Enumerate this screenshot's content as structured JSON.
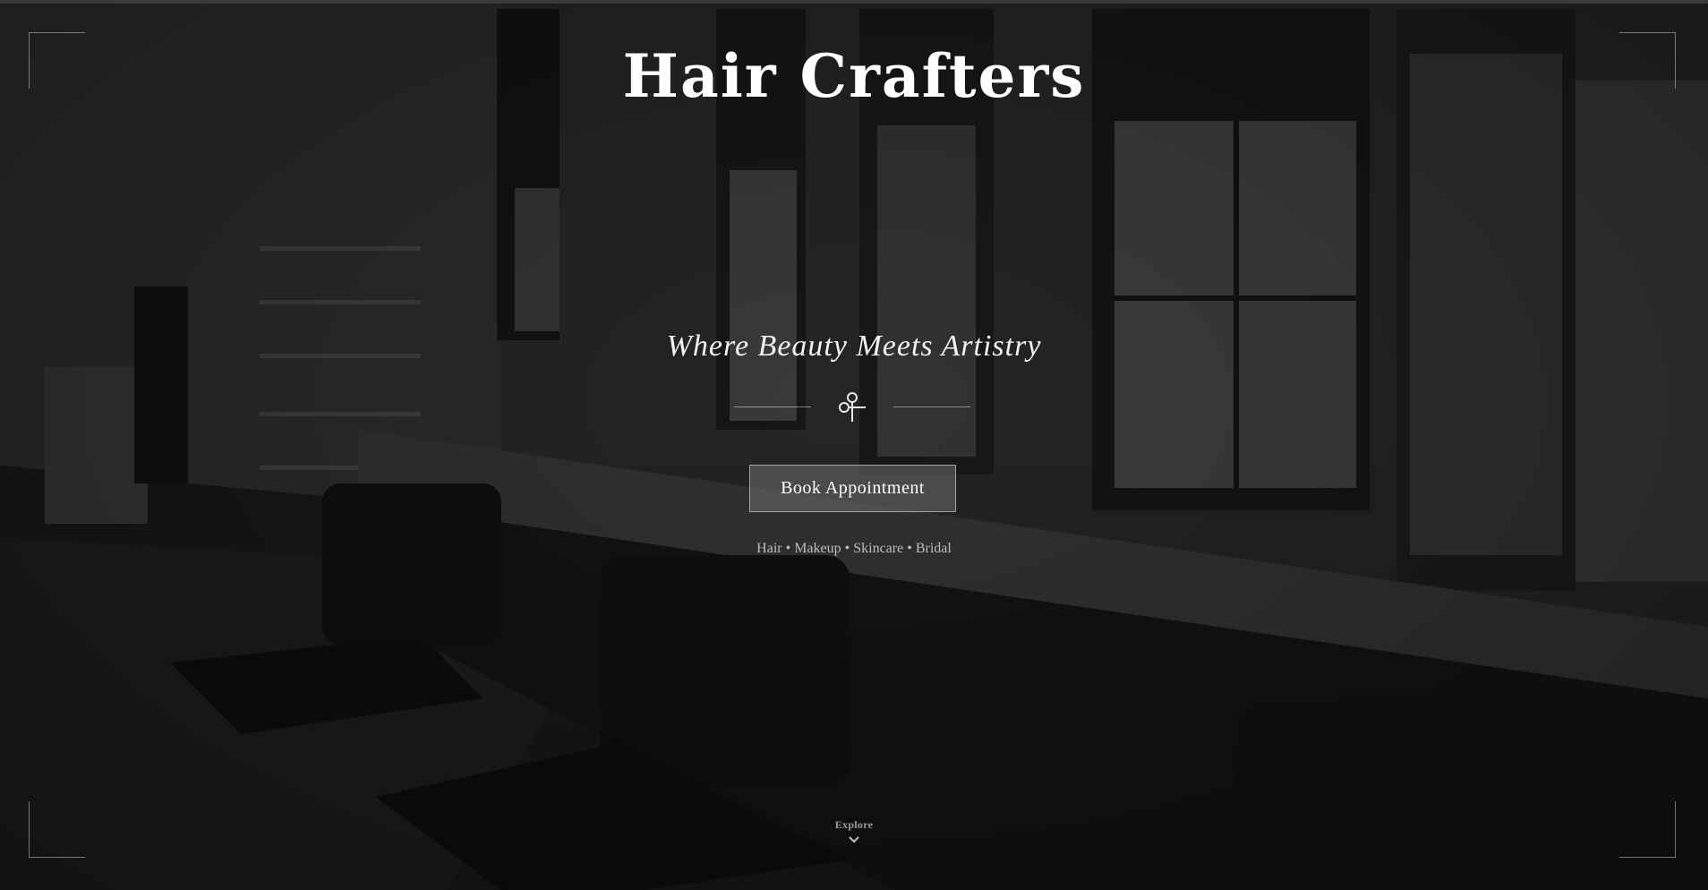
{
  "brand": {
    "title": "Hair Crafters",
    "tagline": "Where Beauty Meets Artistry"
  },
  "divider": {
    "icon": "scissors-icon"
  },
  "cta": {
    "book_label": "Book Appointment"
  },
  "services": {
    "text": "Hair • Makeup • Skincare • Bridal"
  },
  "explore": {
    "label": "Explore",
    "icon": "chevron-down-icon"
  },
  "colors": {
    "text_primary": "#ffffff",
    "text_muted": "#bdbdbd",
    "frame_lines": "#c8c8c8",
    "background_tint": "#262626"
  }
}
